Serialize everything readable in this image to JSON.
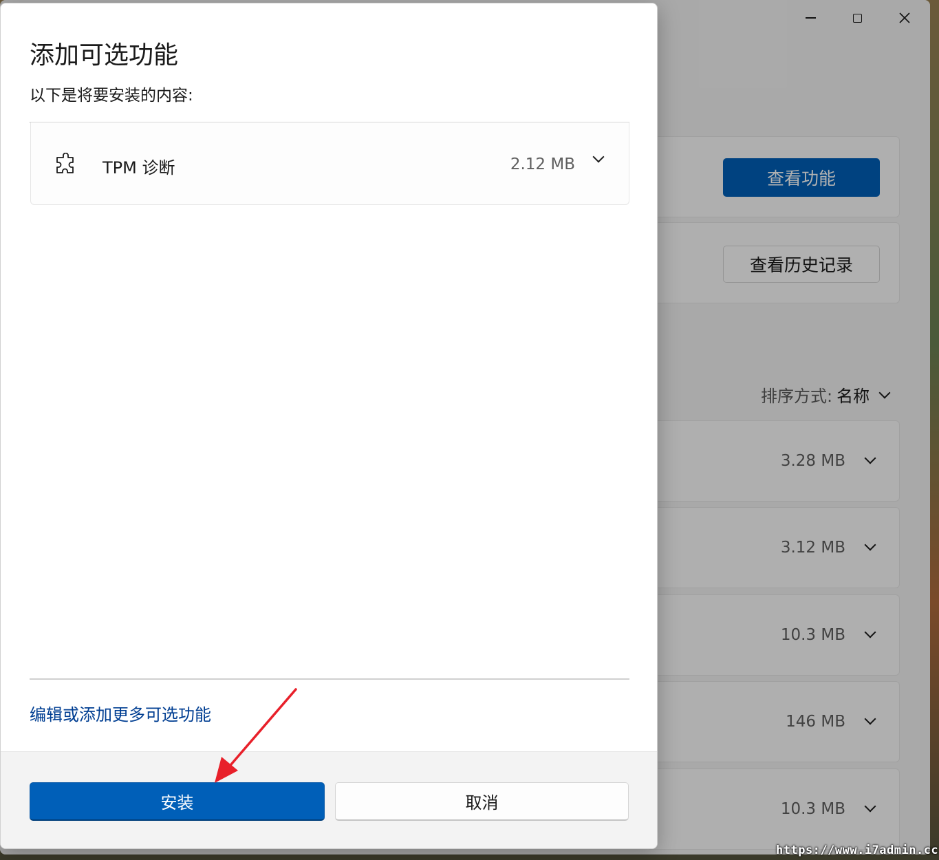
{
  "window": {
    "minimize_icon": "minimize-icon",
    "maximize_icon": "maximize-icon",
    "close_icon": "close-icon"
  },
  "background": {
    "view_features_label": "查看功能",
    "view_history_label": "查看历史记录",
    "sort_label": "排序方式:",
    "sort_value": "名称",
    "features": [
      {
        "size": "3.28 MB"
      },
      {
        "size": "3.12 MB"
      },
      {
        "size": "10.3 MB"
      },
      {
        "size": "146 MB"
      },
      {
        "size": "10.3 MB"
      }
    ]
  },
  "dialog": {
    "title": "添加可选功能",
    "subtitle": "以下是将要安装的内容:",
    "items": [
      {
        "icon": "puzzle-icon",
        "name": "TPM 诊断",
        "size": "2.12 MB"
      }
    ],
    "more_link": "编辑或添加更多可选功能",
    "install_label": "安装",
    "cancel_label": "取消"
  },
  "colors": {
    "accent": "#005fb8",
    "link": "#003e92",
    "annotation_arrow": "#e8202a"
  },
  "watermark": "https://www.i7admin.cc"
}
